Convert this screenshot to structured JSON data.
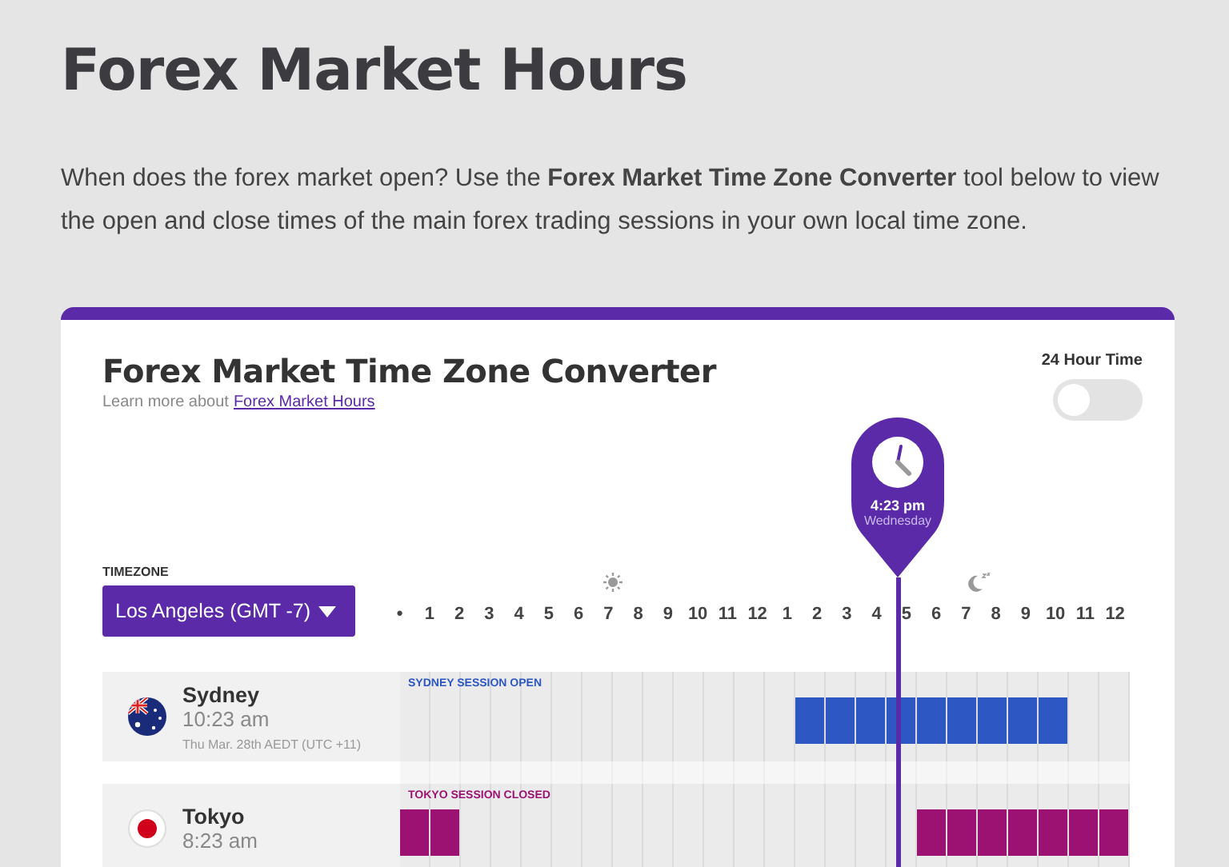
{
  "page": {
    "title": "Forex Market Hours",
    "intro": "When does the forex market open? Use the **Forex Market Time Zone Converter** tool below to view the open and close times of the main forex trading sessions in your own local time zone."
  },
  "converter": {
    "title": "Forex Market Time Zone Converter",
    "subtitle": "Learn more about",
    "subtitle_link": "Forex Market Hours",
    "toggle": {
      "label": "24 Hour Time",
      "on": false
    },
    "timezone": {
      "label": "TIMEZONE",
      "value": "Los Angeles (GMT -7)"
    },
    "hours": [
      "•",
      "1",
      "2",
      "3",
      "4",
      "5",
      "6",
      "7",
      "8",
      "9",
      "10",
      "11",
      "12",
      "1",
      "2",
      "3",
      "4",
      "5",
      "6",
      "7",
      "8",
      "9",
      "10",
      "11",
      "12"
    ],
    "marker": {
      "time": "4:23 pm",
      "day": "Wednesday"
    },
    "sessions": [
      {
        "city": "Sydney",
        "kind": "australia",
        "time": "10:23 am",
        "detail": "Thu Mar. 28th AEDT (UTC +11)",
        "status": "SYDNEY SESSION OPEN",
        "color": "#2d57c2",
        "open_hours": [
          {
            "on": false
          },
          {
            "on": false
          },
          {
            "on": false
          },
          {
            "on": false
          },
          {
            "on": false
          },
          {
            "on": false
          },
          {
            "on": false
          },
          {
            "on": false
          },
          {
            "on": false
          },
          {
            "on": false
          },
          {
            "on": false
          },
          {
            "on": false
          },
          {
            "on": false
          },
          {
            "on": true
          },
          {
            "on": true
          },
          {
            "on": true
          },
          {
            "on": true
          },
          {
            "on": true
          },
          {
            "on": true
          },
          {
            "on": true
          },
          {
            "on": true
          },
          {
            "on": true
          },
          {
            "on": false
          },
          {
            "on": false
          }
        ]
      },
      {
        "city": "Tokyo",
        "kind": "japan",
        "time": "8:23 am",
        "status": "TOKYO SESSION CLOSED",
        "color": "#9c1273",
        "open_hours": [
          {
            "on": true
          },
          {
            "on": true
          },
          {
            "on": false
          },
          {
            "on": false
          },
          {
            "on": false
          },
          {
            "on": false
          },
          {
            "on": false
          },
          {
            "on": false
          },
          {
            "on": false
          },
          {
            "on": false
          },
          {
            "on": false
          },
          {
            "on": false
          },
          {
            "on": false
          },
          {
            "on": false
          },
          {
            "on": false
          },
          {
            "on": false
          },
          {
            "on": false
          },
          {
            "on": true
          },
          {
            "on": true
          },
          {
            "on": true
          },
          {
            "on": true
          },
          {
            "on": true
          },
          {
            "on": true
          },
          {
            "on": true
          }
        ]
      }
    ]
  }
}
